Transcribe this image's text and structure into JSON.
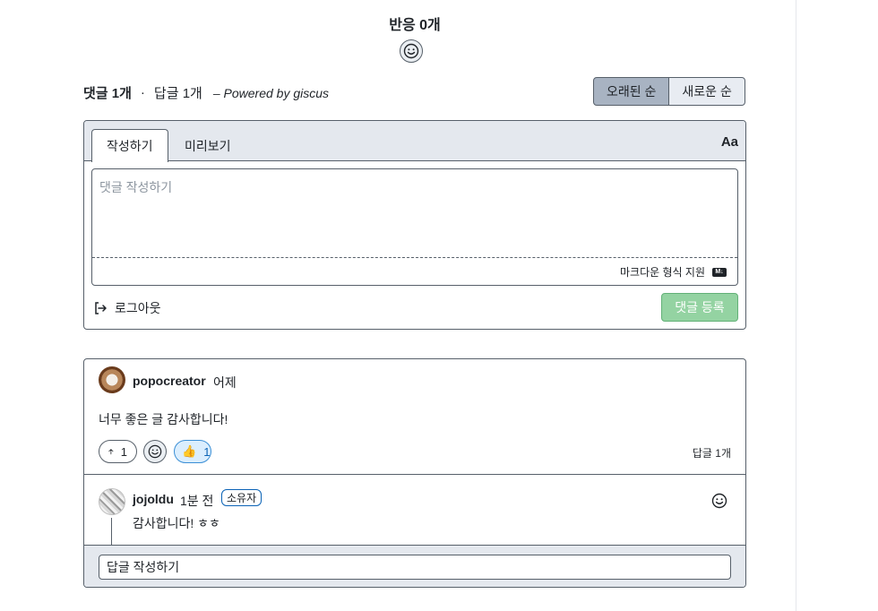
{
  "reactions": {
    "title": "반응 0개"
  },
  "discussion": {
    "comment_count": "댓글 1개",
    "separator": "·",
    "reply_count": "답글 1개",
    "powered_by": "– Powered by giscus"
  },
  "sort": {
    "oldest": "오래된 순",
    "newest": "새로운 순",
    "selected": "오래된 순"
  },
  "editor": {
    "tab_write": "작성하기",
    "tab_preview": "미리보기",
    "font_toggle": "Aa",
    "placeholder": "댓글 작성하기",
    "markdown_note": "마크다운 형식 지원",
    "markdown_icon_text": "M↓",
    "logout": "로그아웃",
    "submit": "댓글 등록"
  },
  "comment": {
    "author": "popocreator",
    "time": "어제",
    "body": "너무 좋은 글 감사합니다!",
    "upvotes": "1",
    "thumbs_emoji": "👍",
    "thumbs_count": "1",
    "reply_count": "답글 1개"
  },
  "reply": {
    "author": "jojoldu",
    "time": "1분 전",
    "badge": "소유자",
    "body": "감사합니다! ㅎㅎ",
    "input_placeholder": "답글 작성하기"
  },
  "colors": {
    "border": "#57606a",
    "header_bg": "#e4e8ee",
    "sort_active_bg": "#a8b3c2",
    "submit_bg": "#94d3a2",
    "reaction_bg": "#dbeefe",
    "owner_badge_border": "#0b63b6"
  },
  "icons": [
    "smiley-icon",
    "arrow-up-icon",
    "logout-icon",
    "markdown-icon",
    "thumbs-up-emoji"
  ]
}
